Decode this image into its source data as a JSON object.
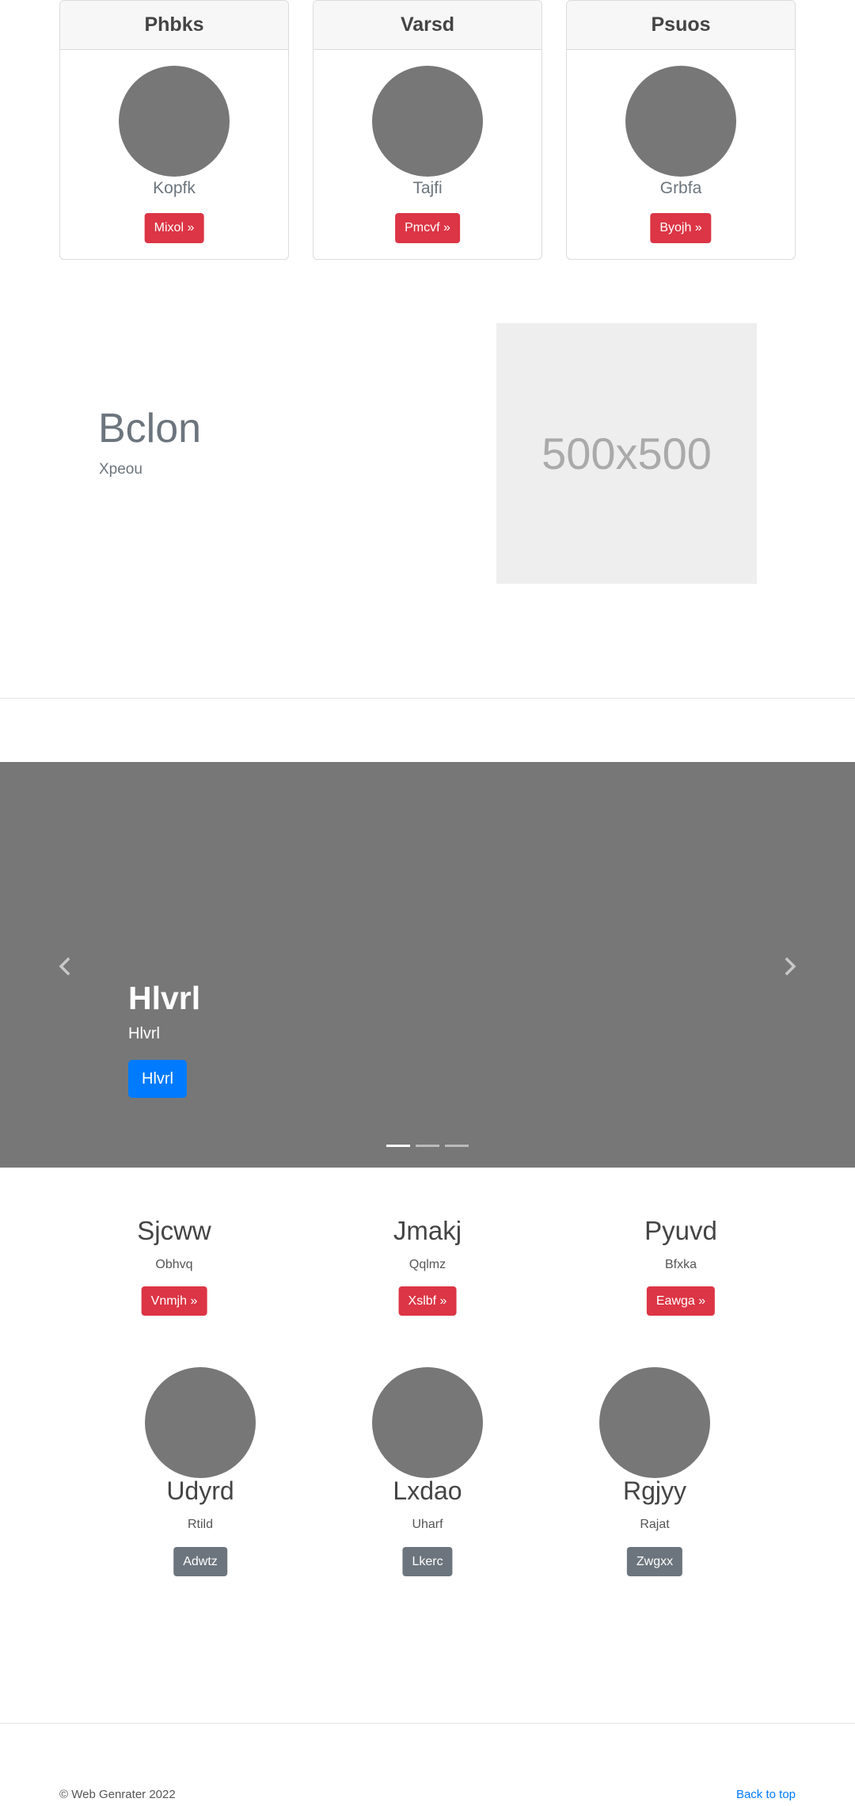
{
  "cards": [
    {
      "title": "Phbks",
      "name": "Kopfk",
      "button": "Mixol »"
    },
    {
      "title": "Varsd",
      "name": "Tajfi",
      "button": "Pmcvf »"
    },
    {
      "title": "Psuos",
      "name": "Grbfa",
      "button": "Byojh »"
    }
  ],
  "feature": {
    "heading": "Bclon",
    "lead": "Xpeou",
    "image_label": "500x500"
  },
  "carousel": {
    "title": "Hlvrl",
    "text": "Hlvrl",
    "button": "Hlvrl",
    "slide_count": 3,
    "active_slide": 1,
    "prev_icon": "chevron-left-icon",
    "next_icon": "chevron-right-icon"
  },
  "columns": [
    {
      "heading": "Sjcww",
      "text": "Obhvq",
      "button": "Vnmjh »"
    },
    {
      "heading": "Jmakj",
      "text": "Qqlmz",
      "button": "Xslbf »"
    },
    {
      "heading": "Pyuvd",
      "text": "Bfxka",
      "button": "Eawga »"
    }
  ],
  "team": [
    {
      "name": "Udyrd",
      "role": "Rtild",
      "button": "Adwtz"
    },
    {
      "name": "Lxdao",
      "role": "Uharf",
      "button": "Lkerc"
    },
    {
      "name": "Rgjyy",
      "role": "Rajat",
      "button": "Zwgxx"
    }
  ],
  "footer": {
    "copyright": "© Web Genrater 2022",
    "back_to_top": "Back to top"
  },
  "colors": {
    "danger": "#dc3545",
    "primary": "#007bff",
    "secondary": "#6c757d",
    "placeholder": "#777777"
  }
}
